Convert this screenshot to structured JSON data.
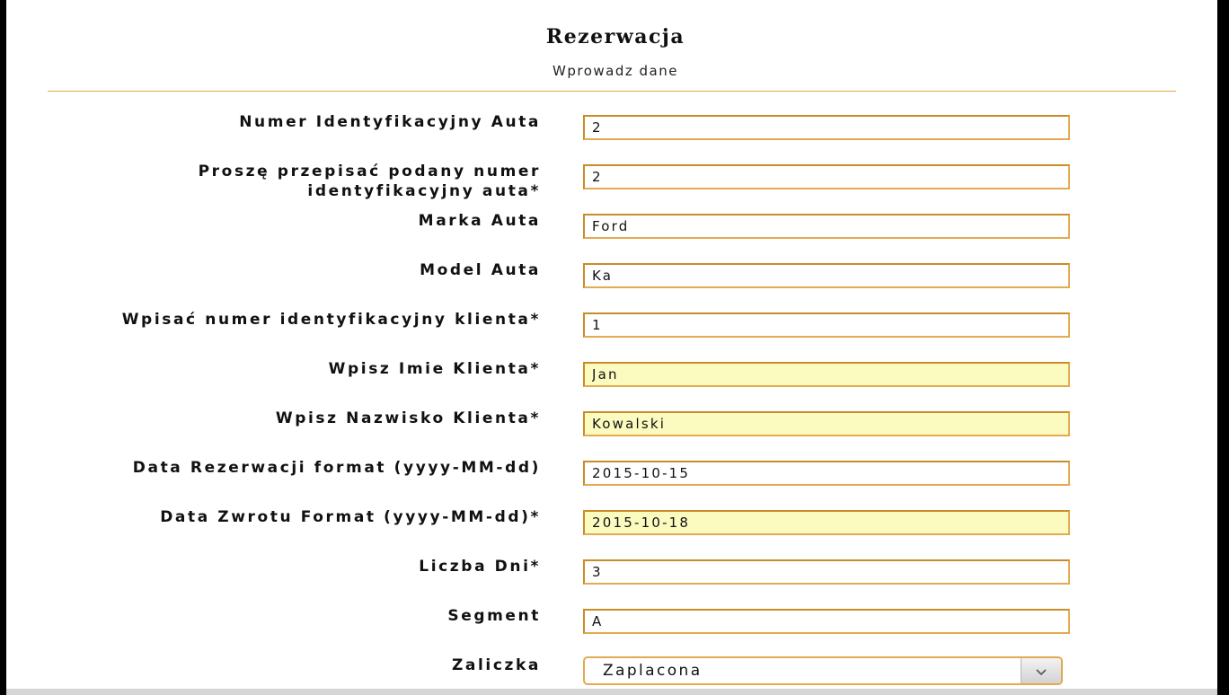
{
  "form": {
    "title": "Rezerwacja",
    "subtitle": "Wprowadz dane",
    "fields": [
      {
        "label": "Numer Identyfikacyjny Auta",
        "value": "2"
      },
      {
        "label": "Proszę przepisać podany numer identyfikacyjny auta*",
        "value": "2"
      },
      {
        "label": "Marka Auta",
        "value": "Ford"
      },
      {
        "label": "Model Auta",
        "value": "Ka"
      },
      {
        "label": "Wpisać numer identyfikacyjny klienta*",
        "value": "1"
      },
      {
        "label": "Wpisz Imie Klienta*",
        "value": "Jan"
      },
      {
        "label": "Wpisz Nazwisko Klienta*",
        "value": "Kowalski"
      },
      {
        "label": "Data Rezerwacji format (yyyy-MM-dd)",
        "value": "2015-10-15"
      },
      {
        "label": "Data Zwrotu Format (yyyy-MM-dd)*",
        "value": "2015-10-18"
      },
      {
        "label": "Liczba Dni*",
        "value": "3"
      },
      {
        "label": "Segment",
        "value": "A"
      }
    ],
    "select": {
      "label": "Zaliczka",
      "selected": "Zaplacona",
      "icon": "chevron-down-icon"
    }
  },
  "colors": {
    "input_border": "#e3aa4f",
    "autofill_background": "#fbfbc0",
    "divider": "#e3a74a",
    "frame": "#000000"
  }
}
